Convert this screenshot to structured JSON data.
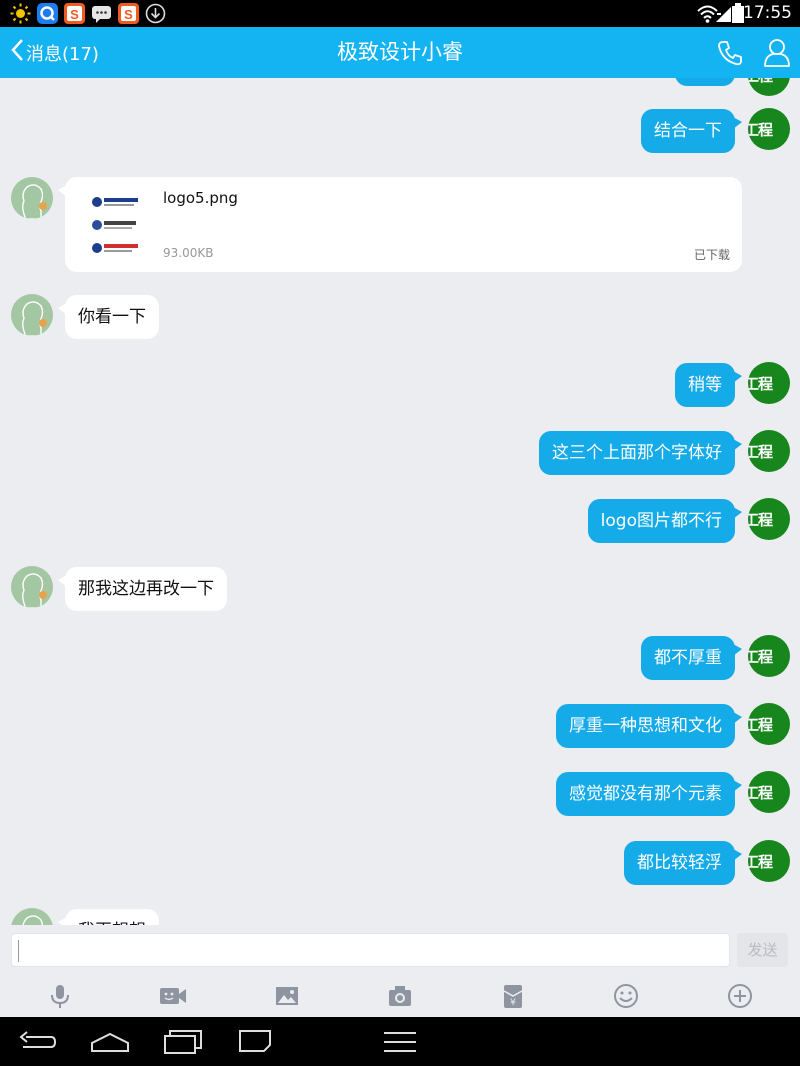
{
  "status_bar": {
    "time": "17:55"
  },
  "header": {
    "back_label": "消息(17)",
    "title": "极致设计小睿"
  },
  "avatars": {
    "self_text": "工程"
  },
  "messages": {
    "m1": "结合一下",
    "file": {
      "name": "logo5.png",
      "size": "93.00KB",
      "status": "已下载"
    },
    "m2": "你看一下",
    "m3": "稍等",
    "m4": "这三个上面那个字体好",
    "m5": "logo图片都不行",
    "m6": "那我这边再改一下",
    "m7": "都不厚重",
    "m8": "厚重一种思想和文化",
    "m9": "感觉都没有那个元素",
    "m10": "都比较轻浮",
    "m11_partial": "我再想想"
  },
  "input": {
    "send_label": "发送"
  },
  "colors": {
    "accent": "#14b3f1",
    "bubble_out": "#15aae8",
    "avatar_self": "#17861c",
    "avatar_other": "#a3c6a3"
  }
}
